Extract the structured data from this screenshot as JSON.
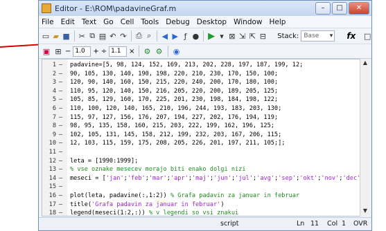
{
  "window": {
    "title": "Editor - E:\\ROM\\padavineGraf.m"
  },
  "menu": [
    "File",
    "Edit",
    "Text",
    "Go",
    "Cell",
    "Tools",
    "Debug",
    "Desktop",
    "Window",
    "Help"
  ],
  "toolbar": {
    "stack_label": "Stack:",
    "stack_value": "Base",
    "fx_label": "fx"
  },
  "cell_toolbar": {
    "value1": "1.0",
    "value2": "1.1",
    "minus": "−",
    "plus": "+",
    "times": "×"
  },
  "code_lines": [
    {
      "n": "1",
      "text": "padavine=[5, 98, 124, 152, 169, 213, 202, 228, 197, 187, 199, 12;",
      "cls": ""
    },
    {
      "n": "2",
      "text": "90, 105, 130, 140, 190, 198, 220, 210, 230, 170, 150, 100;",
      "cls": ""
    },
    {
      "n": "3",
      "text": "120, 90, 140, 160, 150, 215, 220, 240, 200, 170, 180, 100;",
      "cls": ""
    },
    {
      "n": "4",
      "text": "110, 95, 120, 140, 150, 216, 205, 220, 200, 189, 205, 125;",
      "cls": ""
    },
    {
      "n": "5",
      "text": "105, 85, 129, 160, 170, 225, 201, 230, 198, 184, 198, 122;",
      "cls": ""
    },
    {
      "n": "6",
      "text": "110, 100, 120, 140, 165, 210, 196, 244, 193, 183, 203, 130;",
      "cls": ""
    },
    {
      "n": "7",
      "text": "115, 97, 127, 156, 176, 207, 194, 227, 202, 176, 194, 119;",
      "cls": ""
    },
    {
      "n": "8",
      "text": "98, 95, 135, 158, 160, 215, 203, 222, 199, 162, 196, 125;",
      "cls": ""
    },
    {
      "n": "9",
      "text": "102, 105, 131, 145, 158, 212, 199, 232, 203, 167, 206, 115;",
      "cls": ""
    },
    {
      "n": "10",
      "text": "12, 103, 115, 159, 175, 208, 205, 226, 201, 197, 211, 105;];",
      "cls": ""
    },
    {
      "n": "11",
      "text": "",
      "cls": ""
    },
    {
      "n": "12",
      "text": "leta = [1990:1999];",
      "cls": ""
    },
    {
      "n": "13",
      "text": "% vse oznake mesecev morajo biti enako dolgi nizi",
      "cls": "comment"
    },
    {
      "n": "14",
      "text": "meseci = ['jan';'feb';'mar';'apr';'maj';'jun';'jul';'avg';'sep';'okt';'nov';'dec'];",
      "cls": "str"
    },
    {
      "n": "15",
      "text": "",
      "cls": ""
    },
    {
      "n": "16",
      "text": "plot(leta, padavine(:,1:2)) % Grafa padavin za januar in februar",
      "cls": "mixed"
    },
    {
      "n": "17",
      "text": "title('Grafa padavin za januar in februar')",
      "cls": "mixed"
    },
    {
      "n": "18",
      "text": "legend(meseci(1:2,:)) % v legendi so vsi znakui",
      "cls": "mixed"
    },
    {
      "n": "19",
      "text": "",
      "cls": ""
    }
  ],
  "status": {
    "mode": "script",
    "ln_label": "Ln",
    "ln": "11",
    "col_label": "Col",
    "col": "1",
    "ovr": "OVR"
  }
}
